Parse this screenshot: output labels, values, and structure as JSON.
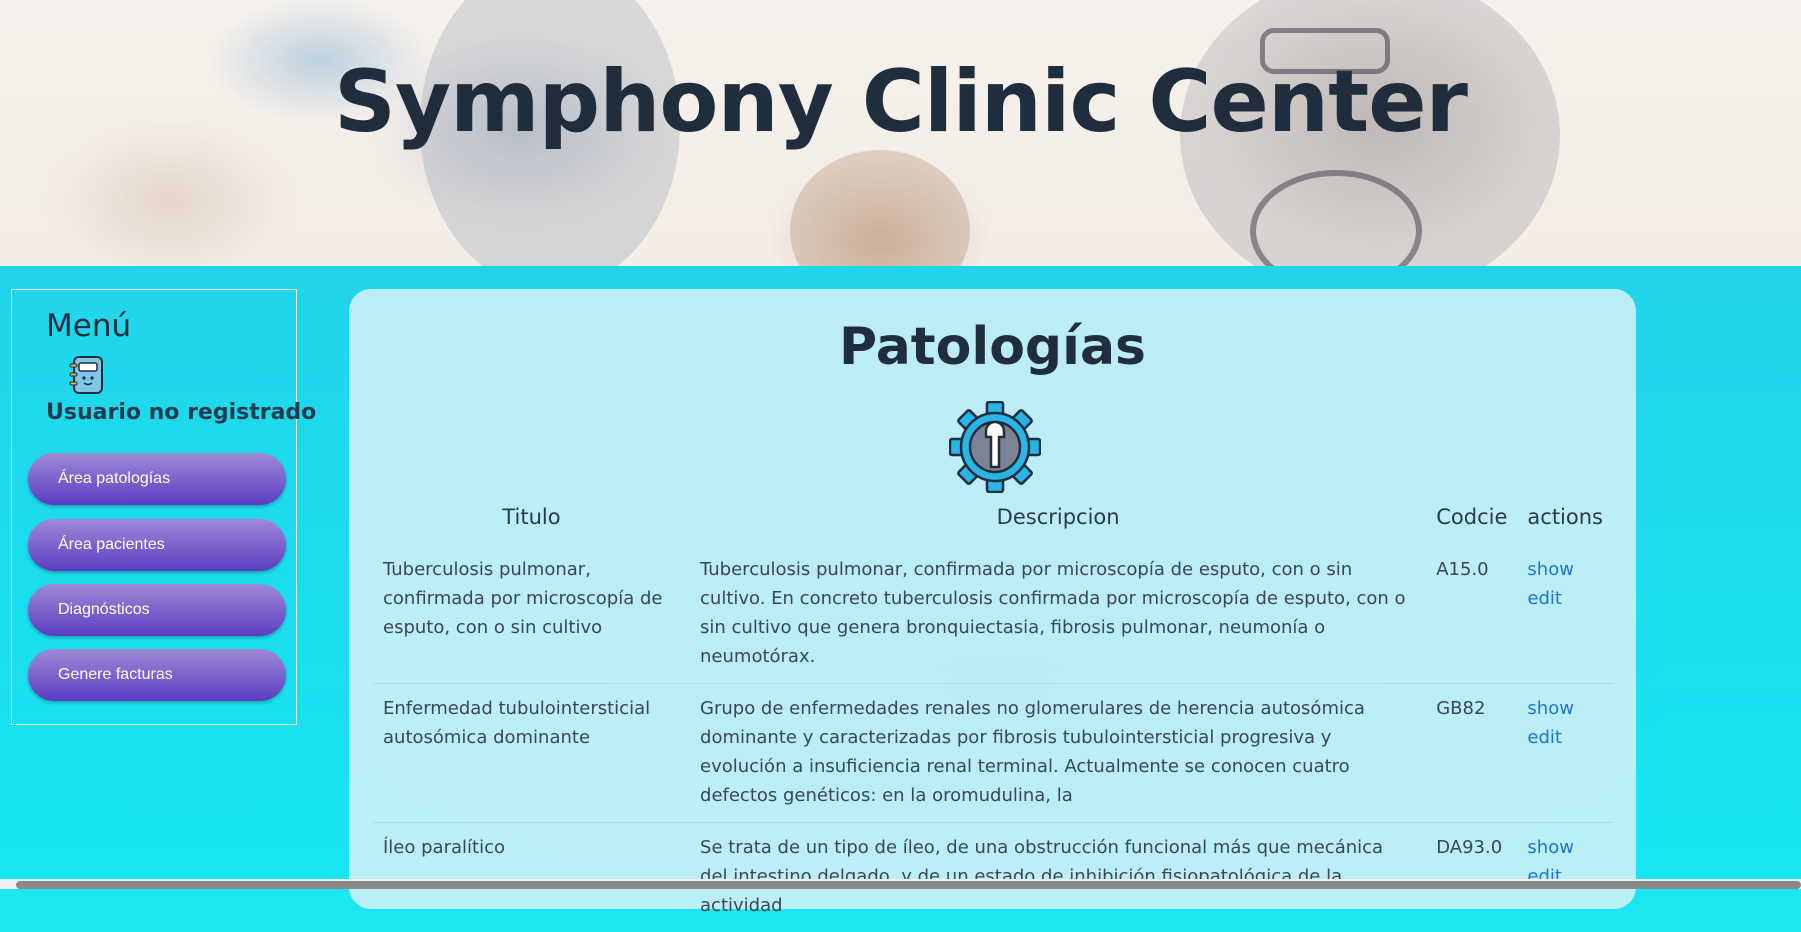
{
  "header": {
    "title": "Symphony Clinic Center"
  },
  "sidebar": {
    "title": "Menú",
    "user_label": "Usuario no registrado",
    "items": [
      {
        "label": "Área patologías"
      },
      {
        "label": "Área pacientes"
      },
      {
        "label": "Diagnósticos"
      },
      {
        "label": "Genere facturas"
      }
    ]
  },
  "main": {
    "title": "Patologías",
    "table": {
      "columns": [
        "Titulo",
        "Descripcion",
        "Codcie",
        "actions"
      ],
      "rows": [
        {
          "titulo": "Tuberculosis pulmonar, confirmada por microscopía de esputo, con o sin cultivo",
          "descripcion": "Tuberculosis pulmonar, confirmada por microscopía de esputo, con o sin cultivo. En concreto tuberculosis confirmada por microscopía de esputo, con o sin cultivo que genera bronquiectasia, fibrosis pulmonar, neumonía o neumotórax.",
          "codcie": "A15.0",
          "show": "show",
          "edit": "edit"
        },
        {
          "titulo": "Enfermedad tubulointersticial autosómica dominante",
          "descripcion": "Grupo de enfermedades renales no glomerulares de herencia autosómica dominante y caracterizadas por fibrosis tubulointersticial progresiva y evolución a insuficiencia renal terminal. Actualmente se conocen cuatro defectos genéticos: en la oromudulina, la",
          "codcie": "GB82",
          "show": "show",
          "edit": "edit"
        },
        {
          "titulo": "Íleo paralítico",
          "descripcion": "Se trata de un tipo de íleo, de una obstrucción funcional más que mecánica del intestino delgado, y de un estado de inhibición fisiopatológica de la actividad",
          "codcie": "DA93.0",
          "show": "show",
          "edit": "edit"
        }
      ]
    }
  }
}
